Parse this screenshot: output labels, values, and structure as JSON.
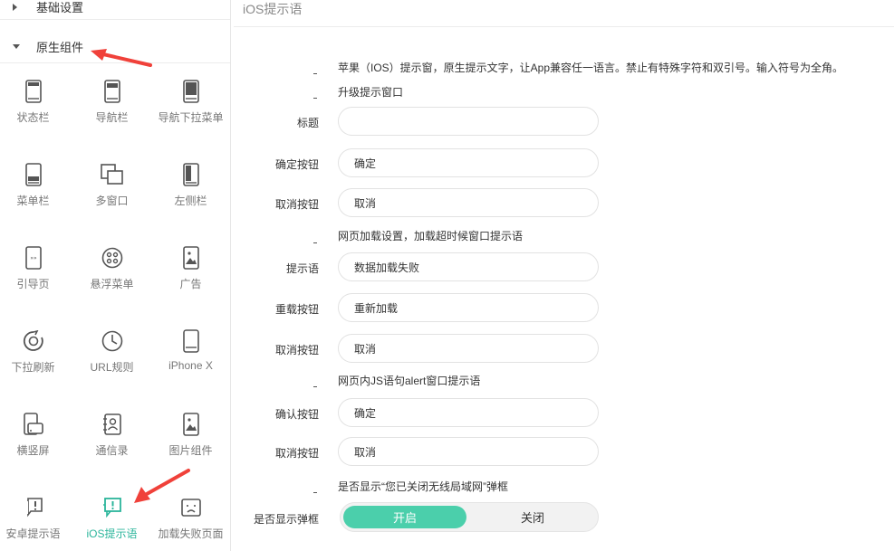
{
  "sidebar": {
    "sections": [
      {
        "label": "基础设置",
        "expanded": false
      },
      {
        "label": "原生组件",
        "expanded": true
      }
    ],
    "items": [
      {
        "label": "状态栏",
        "icon": "phone-icon"
      },
      {
        "label": "导航栏",
        "icon": "phone-icon"
      },
      {
        "label": "导航下拉菜单",
        "icon": "phone-icon"
      },
      {
        "label": "菜单栏",
        "icon": "phone-icon"
      },
      {
        "label": "多窗口",
        "icon": "multi-window-icon"
      },
      {
        "label": "左侧栏",
        "icon": "phone-icon"
      },
      {
        "label": "引导页",
        "icon": "guide-page-icon"
      },
      {
        "label": "悬浮菜单",
        "icon": "floating-menu-icon"
      },
      {
        "label": "广告",
        "icon": "ad-image-icon"
      },
      {
        "label": "下拉刷新",
        "icon": "refresh-icon"
      },
      {
        "label": "URL规则",
        "icon": "clock-icon"
      },
      {
        "label": "iPhone X",
        "icon": "phone-icon"
      },
      {
        "label": "横竖屏",
        "icon": "rotate-screen-icon"
      },
      {
        "label": "通信录",
        "icon": "contacts-icon"
      },
      {
        "label": "图片组件",
        "icon": "image-icon"
      },
      {
        "label": "安卓提示语",
        "icon": "alert-icon"
      },
      {
        "label": "iOS提示语",
        "icon": "alert-icon",
        "active": true
      },
      {
        "label": "加载失败页面",
        "icon": "sad-face-icon"
      }
    ]
  },
  "main": {
    "title": "iOS提示语",
    "description": "苹果（IOS）提示窗，原生提示文字，让App兼容任一语言。禁止有特殊字符和双引号。输入符号为全角。",
    "upgrade_section": "升级提示窗口",
    "fields_upgrade": [
      {
        "label": "标题",
        "value": ""
      },
      {
        "label": "确定按钮",
        "value": "确定"
      },
      {
        "label": "取消按钮",
        "value": "取消"
      }
    ],
    "load_section": "网页加载设置，加载超时候窗口提示语",
    "fields_load": [
      {
        "label": "提示语",
        "value": "数据加载失败"
      },
      {
        "label": "重载按钮",
        "value": "重新加载"
      },
      {
        "label": "取消按钮",
        "value": "取消"
      }
    ],
    "alert_section": "网页内JS语句alert窗口提示语",
    "fields_alert": [
      {
        "label": "确认按钮",
        "value": "确定"
      },
      {
        "label": "取消按钮",
        "value": "取消"
      }
    ],
    "wifi_section": "是否显示“您已关闭无线局域网”弹框",
    "wifi_label": "是否显示弹框",
    "toggle": {
      "on_label": "开启",
      "off_label": "关闭",
      "selected": "开启"
    }
  },
  "colors": {
    "accent": "#4bcfab",
    "active_text": "#2bb59b",
    "arrow": "#f0413a"
  }
}
